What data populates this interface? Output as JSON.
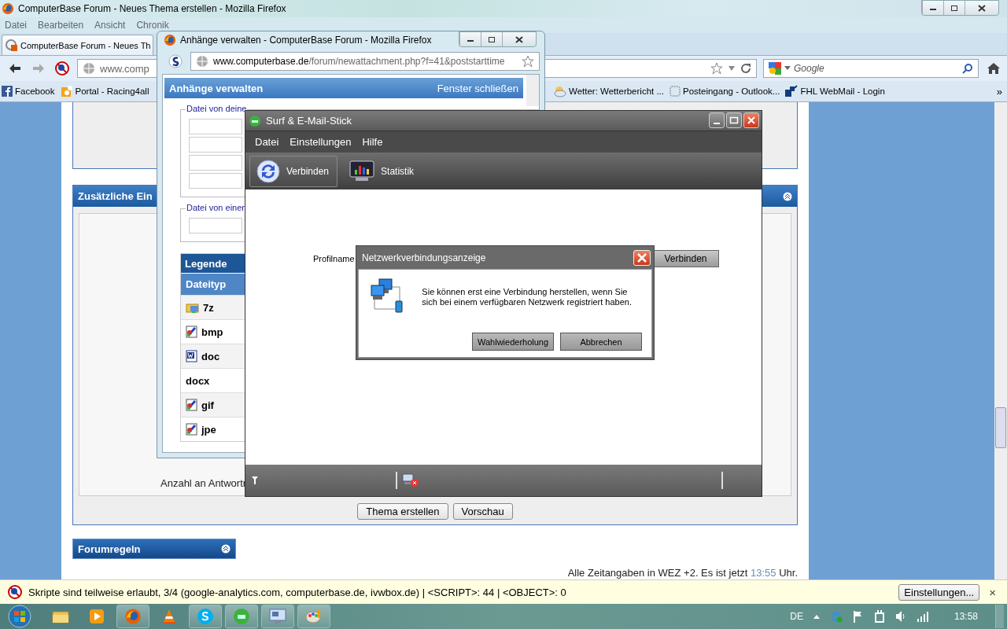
{
  "browser": {
    "title": "ComputerBase Forum - Neues Thema erstellen - Mozilla Firefox",
    "menu": [
      "Datei",
      "Bearbeiten",
      "Ansicht",
      "Chronik"
    ],
    "tab": "ComputerBase Forum - Neues Th",
    "url": "www.comp",
    "search_placeholder": "Google",
    "bookmarks": [
      {
        "label": "Facebook",
        "kind": "facebook"
      },
      {
        "label": "Portal - Racing4all",
        "kind": "portal"
      },
      {
        "label": "Wetter: Wetterbericht ...",
        "kind": "weather"
      },
      {
        "label": "Posteingang - Outlook...",
        "kind": "blank"
      },
      {
        "label": "FHL WebMail - Login",
        "kind": "fhl"
      }
    ],
    "bookmarks_more": "»"
  },
  "forum": {
    "panel_title": "Zusätzliche Ein",
    "reply_label": "Anzahl an Antwortr",
    "buttons": [
      "Thema erstellen",
      "Vorschau"
    ],
    "rules_title": "Forumregeln",
    "footer_before": "Alle Zeitangaben in WEZ +2. Es ist jetzt",
    "footer_time": "13:55",
    "footer_after": "Uhr."
  },
  "popup": {
    "title": "Anhänge verwalten - ComputerBase Forum - Mozilla Firefox",
    "url_host": "www.computerbase.de",
    "url_path": "/forum/newattachment.php?f=41&poststarttime",
    "header": "Anhänge verwalten",
    "close_link": "Fenster schließen",
    "fieldsets": [
      {
        "legend": "Datei von deine",
        "kind": "computer"
      },
      {
        "legend": "Datei von einer",
        "kind": "url"
      }
    ],
    "legend_title": "Legende",
    "column": "Dateityp",
    "rows": [
      {
        "ext": "7z",
        "kind": "archive"
      },
      {
        "ext": "bmp",
        "kind": "image"
      },
      {
        "ext": "doc",
        "kind": "word"
      },
      {
        "ext": "docx",
        "kind": "none"
      },
      {
        "ext": "gif",
        "kind": "image"
      },
      {
        "ext": "jpe",
        "kind": "image"
      }
    ]
  },
  "surf": {
    "title": "Surf & E-Mail-Stick",
    "menu": [
      "Datei",
      "Einstellungen",
      "Hilfe"
    ],
    "toolbar": [
      {
        "label": "Verbinden",
        "kind": "sync",
        "selected": true
      },
      {
        "label": "Statistik",
        "kind": "chart",
        "selected": false
      }
    ],
    "profile_label": "Profilname",
    "connect_button": "Verbinden"
  },
  "dialog": {
    "title": "Netzwerkverbindungsanzeige",
    "message": "Sie können erst eine Verbindung herstellen, wenn Sie sich bei einem verfügbaren Netzwerk registriert haben.",
    "buttons": [
      "Wahlwiederholung",
      "Abbrechen"
    ]
  },
  "notification": {
    "text": "Skripte sind teilweise erlaubt, 3/4 (google-analytics.com, computerbase.de, ivwbox.de) | <SCRIPT>: 44 | <OBJECT>: 0",
    "button": "Einstellungen...",
    "close": "×"
  },
  "taskbar": {
    "apps": [
      {
        "kind": "folder",
        "open": false
      },
      {
        "kind": "media",
        "open": false
      },
      {
        "kind": "firefox",
        "open": true
      },
      {
        "kind": "vlc",
        "open": false
      },
      {
        "kind": "skype",
        "open": true
      },
      {
        "kind": "surf",
        "open": true
      },
      {
        "kind": "display",
        "open": true
      },
      {
        "kind": "paint",
        "open": true
      }
    ],
    "language": "DE",
    "clock": "13:58"
  }
}
